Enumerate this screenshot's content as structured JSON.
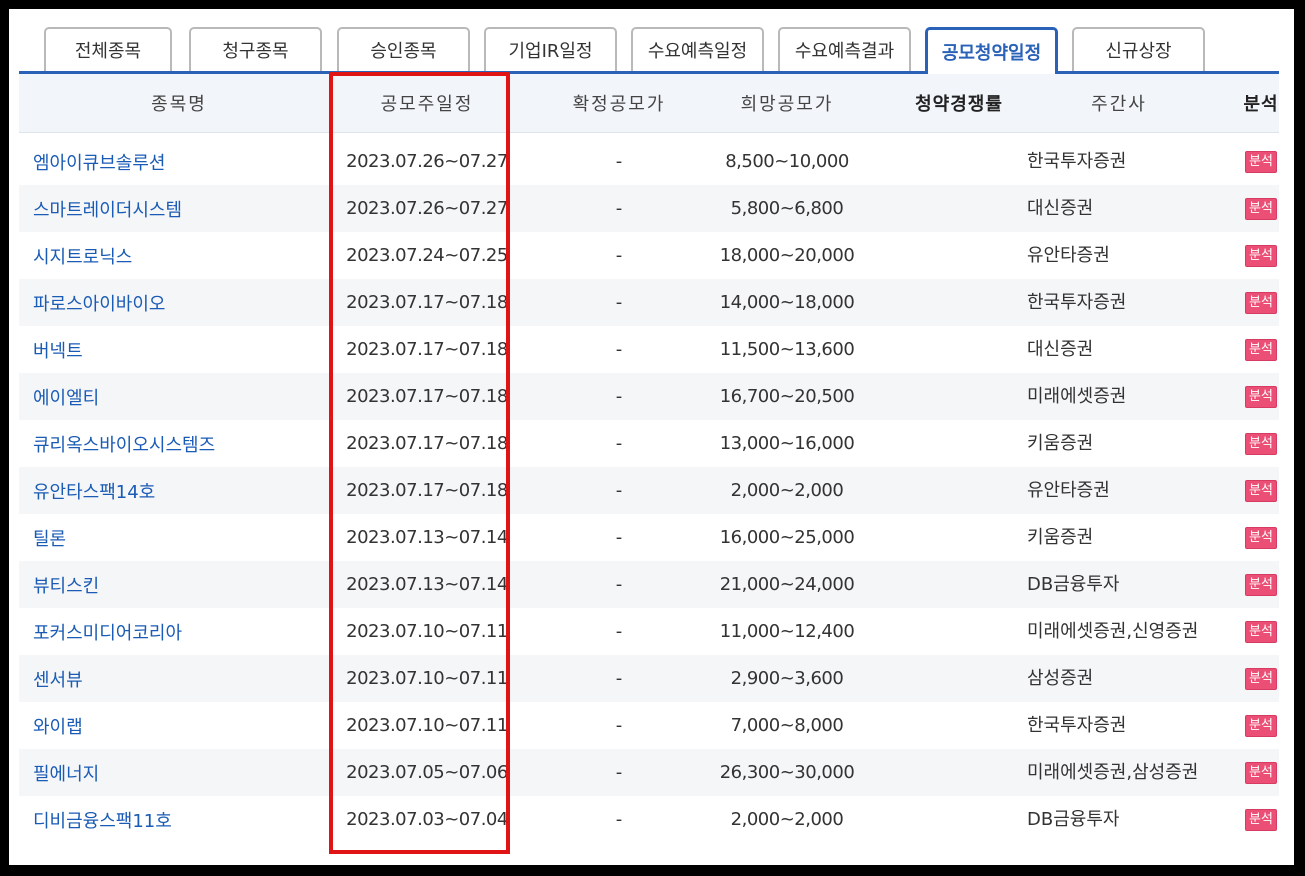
{
  "tabs": [
    {
      "label": "전체종목",
      "active": false
    },
    {
      "label": "청구종목",
      "active": false
    },
    {
      "label": "승인종목",
      "active": false
    },
    {
      "label": "기업IR일정",
      "active": false
    },
    {
      "label": "수요예측일정",
      "active": false
    },
    {
      "label": "수요예측결과",
      "active": false
    },
    {
      "label": "공모청약일정",
      "active": true
    },
    {
      "label": "신규상장",
      "active": false
    }
  ],
  "table": {
    "headers": {
      "name": "종목명",
      "date": "공모주일정",
      "confirmed": "확정공모가",
      "hope": "희망공모가",
      "competition": "청약경쟁률",
      "underwriter": "주간사",
      "analysis": "분석"
    },
    "rows": [
      {
        "name": "엠아이큐브솔루션",
        "date": "2023.07.26~07.27",
        "confirmed": "-",
        "hope": "8,500~10,000",
        "underwriter": "한국투자증권",
        "analysis": "분석"
      },
      {
        "name": "스마트레이더시스템",
        "date": "2023.07.26~07.27",
        "confirmed": "-",
        "hope": "5,800~6,800",
        "underwriter": "대신증권",
        "analysis": "분석"
      },
      {
        "name": "시지트로닉스",
        "date": "2023.07.24~07.25",
        "confirmed": "-",
        "hope": "18,000~20,000",
        "underwriter": "유안타증권",
        "analysis": "분석"
      },
      {
        "name": "파로스아이바이오",
        "date": "2023.07.17~07.18",
        "confirmed": "-",
        "hope": "14,000~18,000",
        "underwriter": "한국투자증권",
        "analysis": "분석"
      },
      {
        "name": "버넥트",
        "date": "2023.07.17~07.18",
        "confirmed": "-",
        "hope": "11,500~13,600",
        "underwriter": "대신증권",
        "analysis": "분석"
      },
      {
        "name": "에이엘티",
        "date": "2023.07.17~07.18",
        "confirmed": "-",
        "hope": "16,700~20,500",
        "underwriter": "미래에셋증권",
        "analysis": "분석"
      },
      {
        "name": "큐리옥스바이오시스템즈",
        "date": "2023.07.17~07.18",
        "confirmed": "-",
        "hope": "13,000~16,000",
        "underwriter": "키움증권",
        "analysis": "분석"
      },
      {
        "name": "유안타스팩14호",
        "date": "2023.07.17~07.18",
        "confirmed": "-",
        "hope": "2,000~2,000",
        "underwriter": "유안타증권",
        "analysis": "분석"
      },
      {
        "name": "틸론",
        "date": "2023.07.13~07.14",
        "confirmed": "-",
        "hope": "16,000~25,000",
        "underwriter": "키움증권",
        "analysis": "분석"
      },
      {
        "name": "뷰티스킨",
        "date": "2023.07.13~07.14",
        "confirmed": "-",
        "hope": "21,000~24,000",
        "underwriter": "DB금융투자",
        "analysis": "분석"
      },
      {
        "name": "포커스미디어코리아",
        "date": "2023.07.10~07.11",
        "confirmed": "-",
        "hope": "11,000~12,400",
        "underwriter": "미래에셋증권,신영증권",
        "analysis": "분석"
      },
      {
        "name": "센서뷰",
        "date": "2023.07.10~07.11",
        "confirmed": "-",
        "hope": "2,900~3,600",
        "underwriter": "삼성증권",
        "analysis": "분석"
      },
      {
        "name": "와이랩",
        "date": "2023.07.10~07.11",
        "confirmed": "-",
        "hope": "7,000~8,000",
        "underwriter": "한국투자증권",
        "analysis": "분석"
      },
      {
        "name": "필에너지",
        "date": "2023.07.05~07.06",
        "confirmed": "-",
        "hope": "26,300~30,000",
        "underwriter": "미래에셋증권,삼성증권",
        "analysis": "분석"
      },
      {
        "name": "디비금융스팩11호",
        "date": "2023.07.03~07.04",
        "confirmed": "-",
        "hope": "2,000~2,000",
        "underwriter": "DB금융투자",
        "analysis": "분석"
      }
    ]
  },
  "colors": {
    "accent": "#2a62b8",
    "link": "#1a5bb5",
    "badge": "#ec4f75",
    "highlight": "#e01414"
  }
}
